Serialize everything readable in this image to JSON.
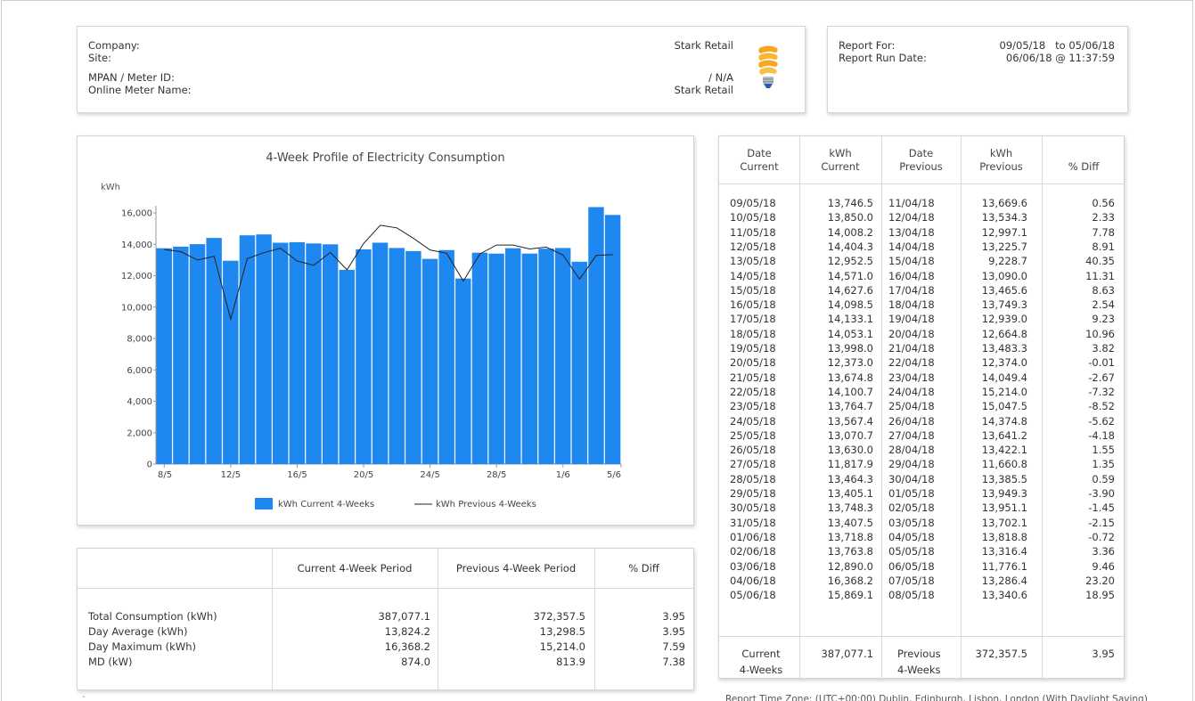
{
  "header": {
    "company_label": "Company:",
    "company_value": "Stark Retail",
    "site_label": "Site:",
    "site_value": "",
    "mpan_label": "MPAN / Meter ID:",
    "mpan_value": "/ N/A",
    "meter_name_label": "Online Meter Name:",
    "meter_name_value": "Stark Retail",
    "logo_icon": "lightbulb-icon"
  },
  "report": {
    "for_label": "Report For:",
    "for_value": "09/05/18   to 05/06/18",
    "run_label": "Report Run Date:",
    "run_value": "06/06/18 @ 11:37:59"
  },
  "chart_data": {
    "type": "bar",
    "title": "4-Week Profile of Electricity Consumption",
    "ylabel": "kWh",
    "ylim": [
      0,
      16000
    ],
    "yticks": [
      "0",
      "2,000",
      "4,000",
      "6,000",
      "8,000",
      "10,000",
      "12,000",
      "14,000",
      "16,000"
    ],
    "xticks": [
      "8/5",
      "12/5",
      "16/5",
      "20/5",
      "24/5",
      "28/5",
      "1/6",
      "5/6"
    ],
    "grid": false,
    "legend_position": "bottom",
    "colors": {
      "bar": "#1e88f0",
      "line": "#222222"
    },
    "series": [
      {
        "name": "kWh Current 4-Weeks",
        "kind": "bar",
        "values": [
          13746.5,
          13850.0,
          14008.2,
          14404.3,
          12952.5,
          14571.0,
          14627.6,
          14098.5,
          14133.1,
          14053.1,
          13998.0,
          12373.0,
          13674.8,
          14100.7,
          13764.7,
          13567.4,
          13070.7,
          13630.0,
          11817.9,
          13464.3,
          13405.1,
          13748.3,
          13407.5,
          13718.8,
          13763.8,
          12890.0,
          16368.2,
          15869.1
        ]
      },
      {
        "name": "kWh Previous 4-Weeks",
        "kind": "line",
        "values": [
          13669.6,
          13534.3,
          12997.1,
          13225.7,
          9228.7,
          13090.0,
          13465.6,
          13749.3,
          12939.0,
          12664.8,
          13483.3,
          12374.0,
          14049.4,
          15214.0,
          15047.5,
          14374.8,
          13641.2,
          13422.1,
          11660.8,
          13385.5,
          13949.3,
          13951.1,
          13702.1,
          13818.8,
          13316.4,
          11776.1,
          13286.4,
          13340.6
        ]
      }
    ]
  },
  "summary": {
    "headers": [
      "Current 4-Week Period",
      "Previous 4-Week Period",
      "% Diff"
    ],
    "rows": [
      {
        "label": "Total Consumption (kWh)",
        "current": "387,077.1",
        "previous": "372,357.5",
        "diff": "3.95"
      },
      {
        "label": "Day Average (kWh)",
        "current": "13,824.2",
        "previous": "13,298.5",
        "diff": "3.95"
      },
      {
        "label": "Day Maximum (kWh)",
        "current": "16,368.2",
        "previous": "15,214.0",
        "diff": "7.59"
      },
      {
        "label": "MD (kW)",
        "current": "874.0",
        "previous": "813.9",
        "diff": "7.38"
      }
    ]
  },
  "daily": {
    "headers": [
      {
        "l1": "Date",
        "l2": "Current"
      },
      {
        "l1": "kWh",
        "l2": "Current"
      },
      {
        "l1": "Date",
        "l2": "Previous"
      },
      {
        "l1": "kWh",
        "l2": "Previous"
      },
      {
        "l1": "",
        "l2": "% Diff"
      }
    ],
    "rows": [
      [
        "09/05/18",
        "13,746.5",
        "11/04/18",
        "13,669.6",
        "0.56"
      ],
      [
        "10/05/18",
        "13,850.0",
        "12/04/18",
        "13,534.3",
        "2.33"
      ],
      [
        "11/05/18",
        "14,008.2",
        "13/04/18",
        "12,997.1",
        "7.78"
      ],
      [
        "12/05/18",
        "14,404.3",
        "14/04/18",
        "13,225.7",
        "8.91"
      ],
      [
        "13/05/18",
        "12,952.5",
        "15/04/18",
        "9,228.7",
        "40.35"
      ],
      [
        "14/05/18",
        "14,571.0",
        "16/04/18",
        "13,090.0",
        "11.31"
      ],
      [
        "15/05/18",
        "14,627.6",
        "17/04/18",
        "13,465.6",
        "8.63"
      ],
      [
        "16/05/18",
        "14,098.5",
        "18/04/18",
        "13,749.3",
        "2.54"
      ],
      [
        "17/05/18",
        "14,133.1",
        "19/04/18",
        "12,939.0",
        "9.23"
      ],
      [
        "18/05/18",
        "14,053.1",
        "20/04/18",
        "12,664.8",
        "10.96"
      ],
      [
        "19/05/18",
        "13,998.0",
        "21/04/18",
        "13,483.3",
        "3.82"
      ],
      [
        "20/05/18",
        "12,373.0",
        "22/04/18",
        "12,374.0",
        "-0.01"
      ],
      [
        "21/05/18",
        "13,674.8",
        "23/04/18",
        "14,049.4",
        "-2.67"
      ],
      [
        "22/05/18",
        "14,100.7",
        "24/04/18",
        "15,214.0",
        "-7.32"
      ],
      [
        "23/05/18",
        "13,764.7",
        "25/04/18",
        "15,047.5",
        "-8.52"
      ],
      [
        "24/05/18",
        "13,567.4",
        "26/04/18",
        "14,374.8",
        "-5.62"
      ],
      [
        "25/05/18",
        "13,070.7",
        "27/04/18",
        "13,641.2",
        "-4.18"
      ],
      [
        "26/05/18",
        "13,630.0",
        "28/04/18",
        "13,422.1",
        "1.55"
      ],
      [
        "27/05/18",
        "11,817.9",
        "29/04/18",
        "11,660.8",
        "1.35"
      ],
      [
        "28/05/18",
        "13,464.3",
        "30/04/18",
        "13,385.5",
        "0.59"
      ],
      [
        "29/05/18",
        "13,405.1",
        "01/05/18",
        "13,949.3",
        "-3.90"
      ],
      [
        "30/05/18",
        "13,748.3",
        "02/05/18",
        "13,951.1",
        "-1.45"
      ],
      [
        "31/05/18",
        "13,407.5",
        "03/05/18",
        "13,702.1",
        "-2.15"
      ],
      [
        "01/06/18",
        "13,718.8",
        "04/05/18",
        "13,818.8",
        "-0.72"
      ],
      [
        "02/06/18",
        "13,763.8",
        "05/05/18",
        "13,316.4",
        "3.36"
      ],
      [
        "03/06/18",
        "12,890.0",
        "06/05/18",
        "11,776.1",
        "9.46"
      ],
      [
        "04/06/18",
        "16,368.2",
        "07/05/18",
        "13,286.4",
        "23.20"
      ],
      [
        "05/06/18",
        "15,869.1",
        "08/05/18",
        "13,340.6",
        "18.95"
      ]
    ],
    "totals": {
      "current_label_1": "Current",
      "current_label_2": "4-Weeks",
      "current_value": "387,077.1",
      "previous_label_1": "Previous",
      "previous_label_2": "4-Weeks",
      "previous_value": "372,357.5",
      "diff": "3.95"
    }
  },
  "footnote": "Report Time Zone: (UTC+00:00) Dublin, Edinburgh, Lisbon, London (With Daylight Saving)",
  "footer_dash": "-"
}
